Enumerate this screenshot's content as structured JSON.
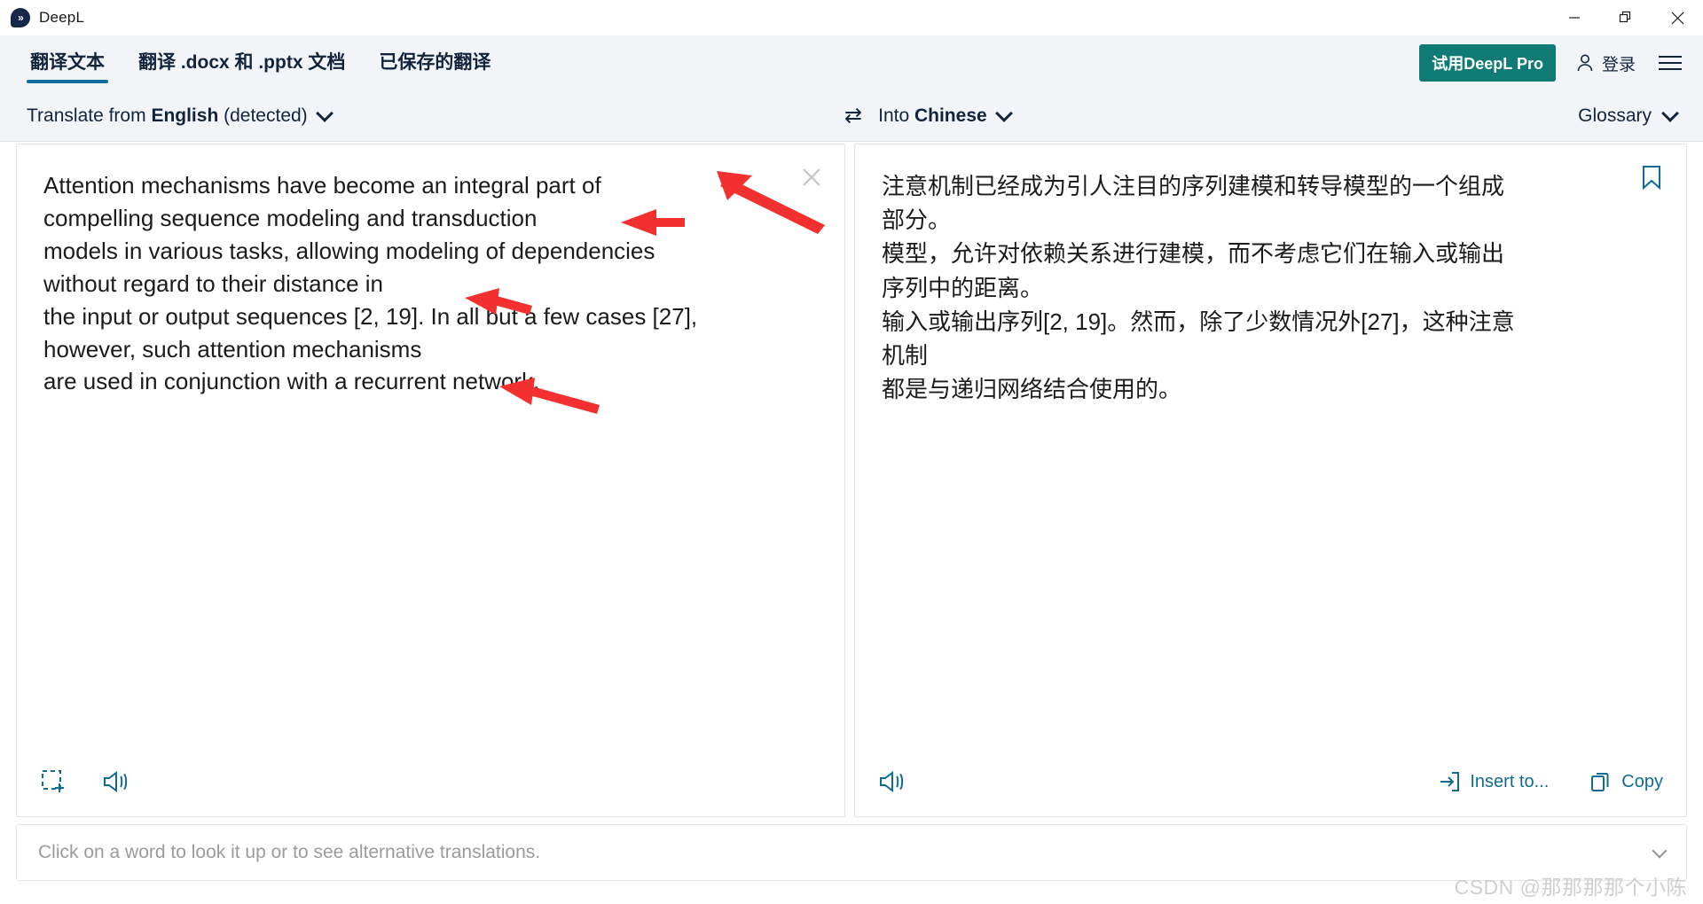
{
  "window": {
    "app_title": "DeepL",
    "logo_icon": "deepl-logo-icon",
    "minimize_label": "—",
    "restore_label": "❐",
    "close_label": "✕"
  },
  "tabs": [
    {
      "label": "翻译文本",
      "active": true
    },
    {
      "label": "翻译 .docx 和 .pptx 文档",
      "active": false
    },
    {
      "label": "已保存的翻译",
      "active": false
    }
  ],
  "header_actions": {
    "pro_button": "试用DeepL Pro",
    "login_label": "登录",
    "login_icon": "person-icon",
    "menu_icon": "hamburger-menu-icon"
  },
  "language_bar": {
    "source_prefix": "Translate from ",
    "source_language": "English",
    "source_suffix": " (detected)",
    "source_chevron_icon": "chevron-down-icon",
    "swap_icon": "swap-languages-icon",
    "target_prefix": "Into ",
    "target_language": "Chinese",
    "target_chevron_icon": "chevron-down-icon",
    "glossary_label": "Glossary",
    "glossary_chevron_icon": "chevron-down-icon"
  },
  "source_pane": {
    "text": "Attention mechanisms have become an integral part of\ncompelling sequence modeling and transduction\nmodels in various tasks, allowing modeling of dependencies\nwithout regard to their distance in\nthe input or output sequences [2, 19]. In all but a few cases [27],\nhowever, such attention mechanisms\nare used in conjunction with a recurrent network.",
    "clear_icon": "close-icon",
    "capture_icon": "screenshot-capture-icon",
    "speaker_icon": "speaker-icon"
  },
  "target_pane": {
    "text": "注意机制已经成为引人注目的序列建模和转导模型的一个组成\n部分。\n模型，允许对依赖关系进行建模，而不考虑它们在输入或输出\n序列中的距离。\n输入或输出序列[2, 19]。然而，除了少数情况外[27]，这种注意\n机制\n都是与递归网络结合使用的。",
    "bookmark_icon": "bookmark-icon",
    "speaker_icon": "speaker-icon",
    "insert_label": "Insert to...",
    "insert_icon": "insert-arrow-icon",
    "copy_label": "Copy",
    "copy_icon": "copy-icon"
  },
  "alt_bar": {
    "hint": "Click on a word to look it up or to see alternative translations.",
    "chevron_icon": "chevron-down-icon"
  },
  "watermark": {
    "text": "CSDN @那那那那个小陈"
  },
  "colors": {
    "accent_teal": "#0f7b74",
    "accent_blue": "#0f6b96",
    "tab_underline": "#0f6f9e",
    "header_bg": "#f2f4f8",
    "annotation_red": "#f23030"
  }
}
